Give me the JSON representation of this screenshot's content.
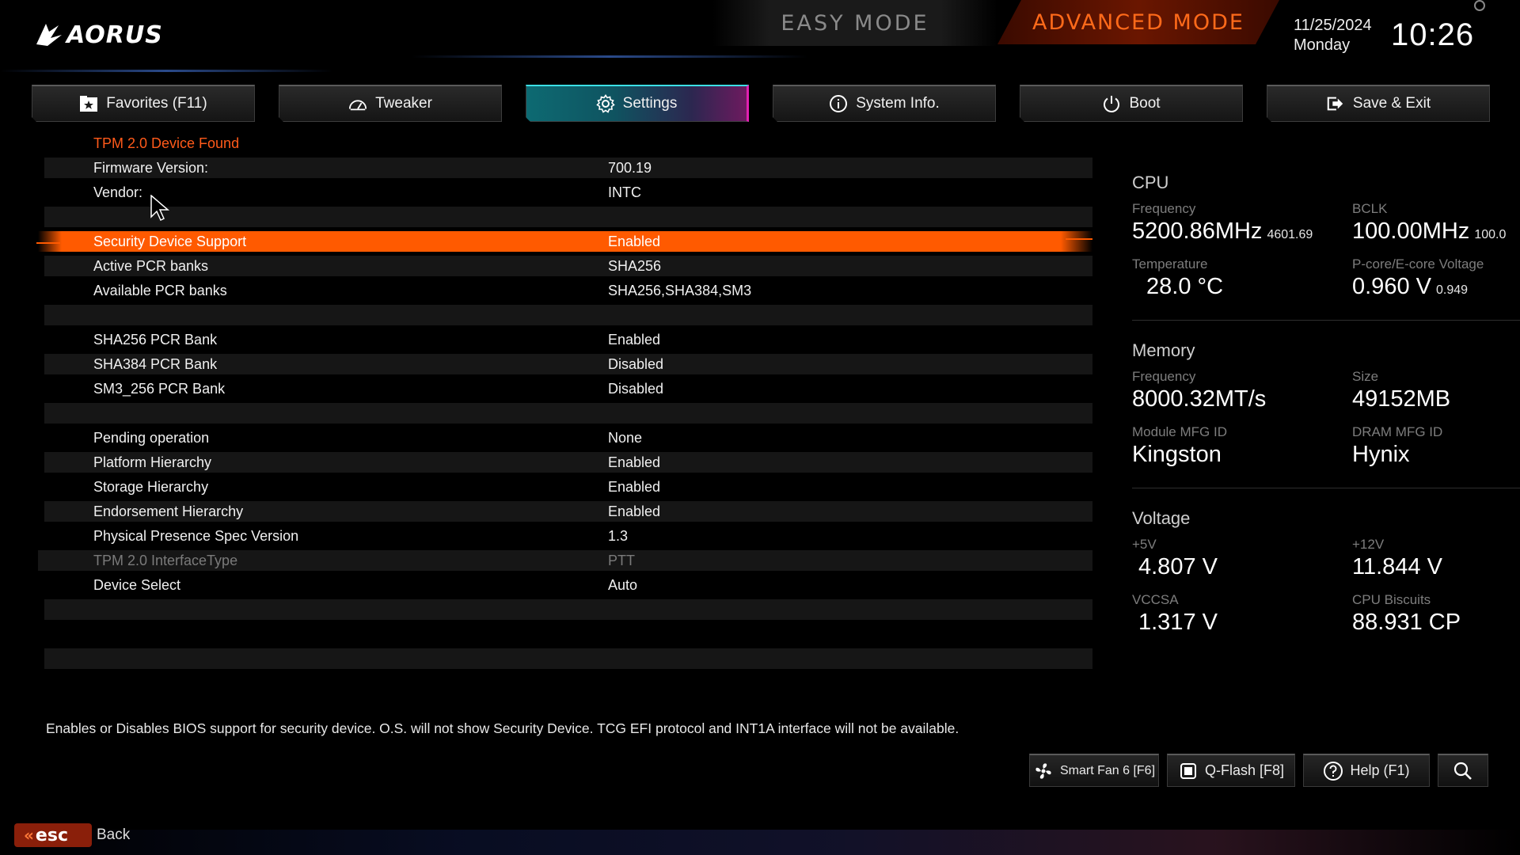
{
  "header": {
    "logo_text": "AORUS",
    "easy_mode_label": "EASY MODE",
    "advanced_mode_label": "ADVANCED MODE",
    "date": "11/25/2024",
    "day": "Monday",
    "time": "10:26"
  },
  "tabs": [
    {
      "label": "Favorites (F11)",
      "icon": "star-folder-icon"
    },
    {
      "label": "Tweaker",
      "icon": "speedometer-icon"
    },
    {
      "label": "Settings",
      "icon": "gear-icon",
      "active": true
    },
    {
      "label": "System Info.",
      "icon": "info-icon"
    },
    {
      "label": "Boot",
      "icon": "power-icon"
    },
    {
      "label": "Save & Exit",
      "icon": "exit-icon"
    }
  ],
  "settings": {
    "section_title": "TPM 2.0 Device Found",
    "rows": [
      {
        "label": "Firmware Version:",
        "value": "700.19"
      },
      {
        "label": "Vendor:",
        "value": "INTC"
      },
      {
        "label": "Security Device Support",
        "value": "Enabled",
        "selected": true
      },
      {
        "label": "Active PCR banks",
        "value": "SHA256"
      },
      {
        "label": "Available PCR banks",
        "value": "SHA256,SHA384,SM3"
      },
      {
        "label": "SHA256 PCR Bank",
        "value": "Enabled"
      },
      {
        "label": "SHA384 PCR Bank",
        "value": "Disabled"
      },
      {
        "label": "SM3_256 PCR Bank",
        "value": "Disabled"
      },
      {
        "label": "Pending operation",
        "value": "None"
      },
      {
        "label": "Platform Hierarchy",
        "value": "Enabled"
      },
      {
        "label": "Storage Hierarchy",
        "value": "Enabled"
      },
      {
        "label": "Endorsement Hierarchy",
        "value": "Enabled"
      },
      {
        "label": "Physical Presence Spec Version",
        "value": "1.3"
      },
      {
        "label": "TPM 2.0 InterfaceType",
        "value": "PTT",
        "disabled": true
      },
      {
        "label": "Device Select",
        "value": "Auto"
      }
    ]
  },
  "info_panel": {
    "cpu": {
      "title": "CPU",
      "frequency_label": "Frequency",
      "frequency": "5200.86MHz",
      "frequency_sub": "4601.69",
      "bclk_label": "BCLK",
      "bclk": "100.00MHz",
      "bclk_sub": "100.0",
      "temperature_label": "Temperature",
      "temperature": "28.0 °C",
      "voltage_label": "P-core/E-core Voltage",
      "voltage": "0.960 V",
      "voltage_sub": "0.949"
    },
    "memory": {
      "title": "Memory",
      "frequency_label": "Frequency",
      "frequency": "8000.32MT/s",
      "size_label": "Size",
      "size": "49152MB",
      "module_label": "Module MFG ID",
      "module": "Kingston",
      "dram_label": "DRAM MFG ID",
      "dram": "Hynix"
    },
    "voltage": {
      "title": "Voltage",
      "v5_label": "+5V",
      "v5": "4.807 V",
      "v12_label": "+12V",
      "v12": "11.844 V",
      "vccsa_label": "VCCSA",
      "vccsa": "1.317 V",
      "biscuits_label": "CPU Biscuits",
      "biscuits": "88.931 CP"
    }
  },
  "help_text": "Enables or Disables BIOS support for security device. O.S. will not show Security Device. TCG EFI protocol and INT1A interface will not be available.",
  "bottom_buttons": [
    {
      "label": "Smart Fan 6 [F6]",
      "icon": "fan-icon"
    },
    {
      "label": "Q-Flash [F8]",
      "icon": "chip-icon"
    },
    {
      "label": "Help (F1)",
      "icon": "help-icon"
    },
    {
      "label": "",
      "icon": "search-icon"
    }
  ],
  "footer": {
    "esc_label": "esc",
    "back_label": "Back"
  },
  "colors": {
    "accent": "#ff5a00",
    "tab_active_start": "#0d6a72",
    "tab_active_end": "#e020b0",
    "label_grey": "#7d7d7d"
  }
}
